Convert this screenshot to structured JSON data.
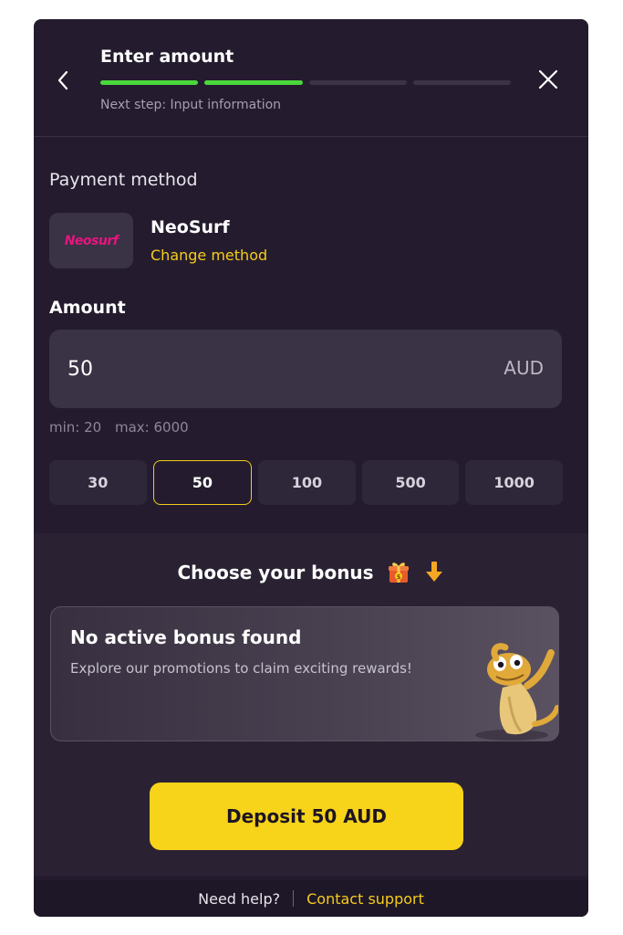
{
  "header": {
    "title": "Enter amount",
    "next_step": "Next step: Input information",
    "progress": {
      "total_steps": 4,
      "completed_steps": 2
    },
    "colors": {
      "progress_done": "#4ad83b",
      "progress_pending": "#3b3346"
    }
  },
  "payment": {
    "label": "Payment method",
    "logo_text": "Neosurf",
    "name": "NeoSurf",
    "change_label": "Change method"
  },
  "amount": {
    "label": "Amount",
    "value": "50",
    "currency": "AUD",
    "min_text": "min: 20",
    "max_text": "max: 6000",
    "quick_values": [
      "30",
      "50",
      "100",
      "500",
      "1000"
    ],
    "selected": "50"
  },
  "bonus": {
    "title": "Choose your bonus",
    "card_title": "No active bonus found",
    "card_subtitle": "Explore our promotions to claim exciting rewards!"
  },
  "deposit_button": "Deposit 50 AUD",
  "footer": {
    "help": "Need help?",
    "contact": "Contact support"
  },
  "colors": {
    "accent": "#f7d31a",
    "background": "#241c2e",
    "brand_neosurf": "#e7157d"
  },
  "icons": [
    "chevron-left-icon",
    "close-icon",
    "gift-icon",
    "arrow-down-icon",
    "mascot-illustration"
  ]
}
